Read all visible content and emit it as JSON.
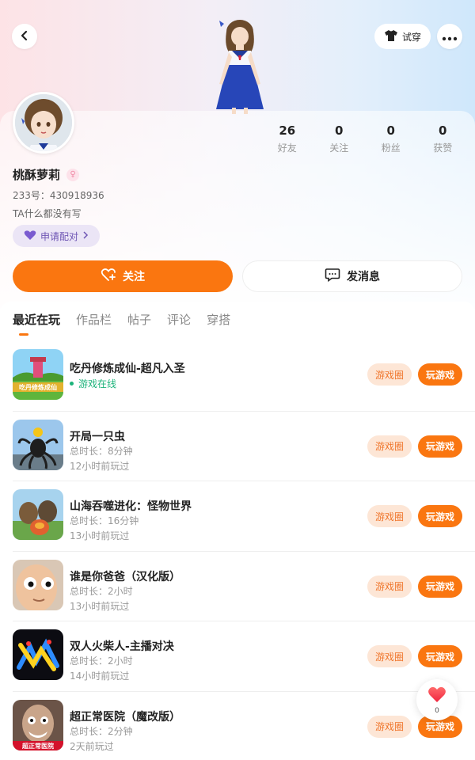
{
  "header": {
    "tryon_label": "试穿"
  },
  "profile": {
    "name": "桃酥萝莉",
    "uid": "233号：430918936",
    "bio": "TA什么都没有写",
    "pair_label": "申请配对",
    "stats": [
      {
        "value": "26",
        "label": "好友"
      },
      {
        "value": "0",
        "label": "关注"
      },
      {
        "value": "0",
        "label": "粉丝"
      },
      {
        "value": "0",
        "label": "获赞"
      }
    ]
  },
  "actions": {
    "follow_label": "关注",
    "message_label": "发消息"
  },
  "tabs": [
    "最近在玩",
    "作品栏",
    "帖子",
    "评论",
    "穿搭"
  ],
  "games": [
    {
      "title": "吃丹修炼成仙-超凡入圣",
      "status": "游戏在线",
      "circle": "游戏圈",
      "play": "玩游戏",
      "thumb_color": "#5fb53c"
    },
    {
      "title": "开局一只虫",
      "duration": "总时长：8分钟",
      "last_played": "12小时前玩过",
      "circle": "游戏圈",
      "play": "玩游戏",
      "thumb_color": "#6aa6d8"
    },
    {
      "title": "山海吞噬进化：怪物世界",
      "duration": "总时长：16分钟",
      "last_played": "13小时前玩过",
      "circle": "游戏圈",
      "play": "玩游戏",
      "thumb_color": "#8fb85d"
    },
    {
      "title": "谁是你爸爸（汉化版）",
      "duration": "总时长：2小时",
      "last_played": "13小时前玩过",
      "circle": "游戏圈",
      "play": "玩游戏",
      "thumb_color": "#e7b48f"
    },
    {
      "title": "双人火柴人-主播对决",
      "duration": "总时长：2小时",
      "last_played": "14小时前玩过",
      "circle": "游戏圈",
      "play": "玩游戏",
      "thumb_color": "#0c0c12"
    },
    {
      "title": "超正常医院（魔改版）",
      "duration": "总时长：2分钟",
      "last_played": "2天前玩过",
      "circle": "游戏圈",
      "play": "玩游戏",
      "thumb_color": "#6b5448"
    }
  ],
  "thumb_captions": {
    "game1": "吃丹修炼成仙",
    "game6": "超正常医院"
  },
  "like": {
    "count": "0"
  },
  "colors": {
    "accent": "#fa7610",
    "online": "#1cb37a"
  }
}
